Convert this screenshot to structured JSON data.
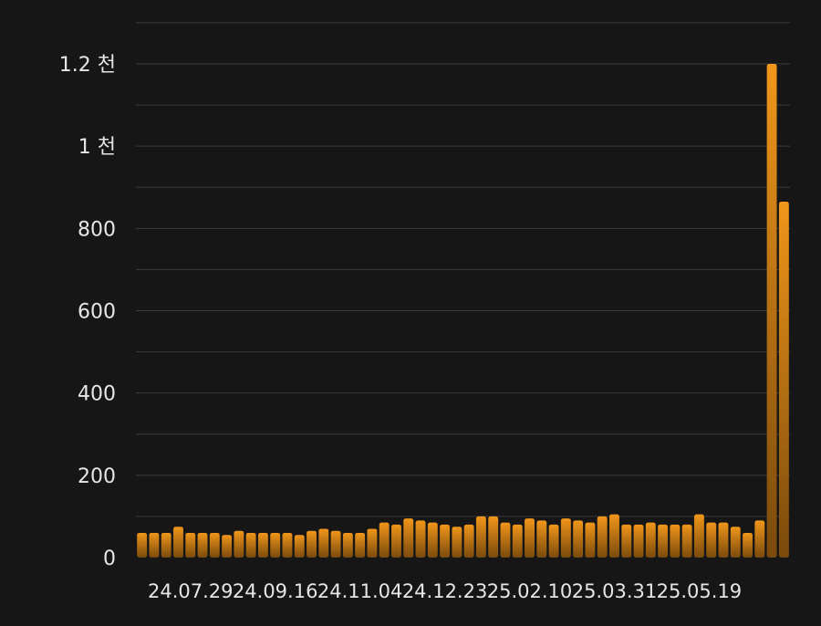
{
  "chart_data": {
    "type": "bar",
    "colors": {
      "bar_top": "#f0961a",
      "bar_bottom": "#7a4a0c",
      "background": "#161616",
      "grid": "#3a3a3a",
      "text": "#e6e6e6"
    },
    "ylim": [
      0,
      1300
    ],
    "grid": true,
    "y_ticks": [
      {
        "value": 0,
        "label": "0"
      },
      {
        "value": 200,
        "label": "200"
      },
      {
        "value": 400,
        "label": "400"
      },
      {
        "value": 600,
        "label": "600"
      },
      {
        "value": 800,
        "label": "800"
      },
      {
        "value": 1000,
        "label": "1 천"
      },
      {
        "value": 1200,
        "label": "1.2 천"
      }
    ],
    "x_ticks": [
      {
        "index": 4,
        "label": "24.07.29"
      },
      {
        "index": 11,
        "label": "24.09.16"
      },
      {
        "index": 18,
        "label": "24.11.04"
      },
      {
        "index": 25,
        "label": "24.12.23"
      },
      {
        "index": 32,
        "label": "25.02.10"
      },
      {
        "index": 39,
        "label": "25.03.31"
      },
      {
        "index": 46,
        "label": "25.05.19"
      }
    ],
    "values": [
      60,
      60,
      60,
      75,
      60,
      60,
      60,
      55,
      65,
      60,
      60,
      60,
      60,
      55,
      65,
      70,
      65,
      60,
      60,
      70,
      85,
      80,
      95,
      90,
      85,
      80,
      75,
      80,
      100,
      100,
      85,
      80,
      95,
      90,
      80,
      95,
      90,
      85,
      100,
      105,
      80,
      80,
      85,
      80,
      80,
      80,
      105,
      85,
      85,
      75,
      60,
      90,
      1200,
      865
    ]
  }
}
